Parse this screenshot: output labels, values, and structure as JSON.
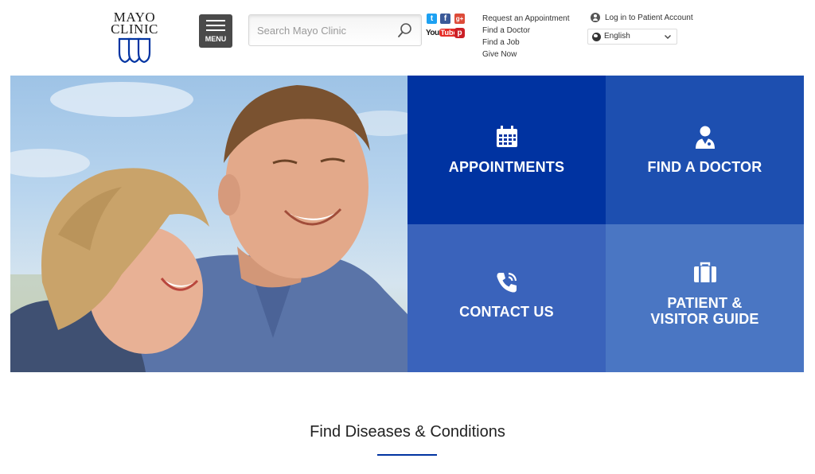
{
  "logo": {
    "line1": "MAYO",
    "line2": "CLINIC",
    "icon": "three-shields-logo"
  },
  "menu": {
    "label": "MENU",
    "icon": "hamburger-icon"
  },
  "search": {
    "placeholder": "Search Mayo Clinic",
    "value": "",
    "icon": "search-icon"
  },
  "social": {
    "twitter": "twitter-icon",
    "facebook": "facebook-icon",
    "googleplus": "google-plus-icon",
    "youtube": {
      "you": "You",
      "tube": "Tube"
    },
    "pinterest": "pinterest-icon"
  },
  "quick_links": [
    "Request an Appointment",
    "Find a Doctor",
    "Find a Job",
    "Give Now"
  ],
  "account": {
    "label": "Log in to Patient Account",
    "icon": "user-circle-icon"
  },
  "language": {
    "selected": "English",
    "icon": "globe-icon"
  },
  "hero": {
    "photo": "smiling-couple-photo",
    "tiles": [
      {
        "label": "APPOINTMENTS",
        "icon": "calendar-icon",
        "color": "#0033a1"
      },
      {
        "label": "FIND A DOCTOR",
        "icon": "doctor-icon",
        "color": "#1d4fb0"
      },
      {
        "label": "CONTACT US",
        "icon": "phone-icon",
        "color": "#3a63bb"
      },
      {
        "label_line1": "PATIENT &",
        "label_line2": "VISITOR GUIDE",
        "icon": "briefcase-icon",
        "color": "#4a76c3"
      }
    ]
  },
  "section": {
    "title": "Find Diseases & Conditions"
  },
  "colors": {
    "brand_blue": "#0033a1",
    "menu_bg": "#4a4a4a"
  }
}
